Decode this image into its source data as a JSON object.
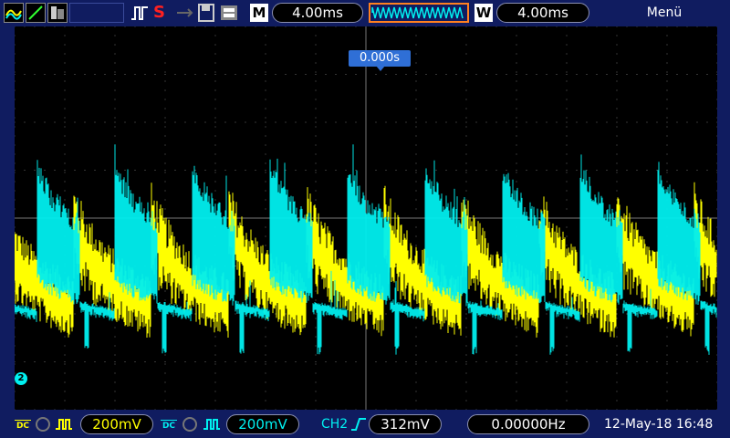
{
  "toolbar": {
    "timebase": "4.00ms",
    "window_timebase": "4.00ms",
    "m_label": "M",
    "w_label": "W",
    "menu_label": "Menü",
    "stop_label": "S"
  },
  "screen": {
    "trigger_position": "0.000s",
    "channel_marker": "2"
  },
  "status": {
    "ch1_coupling": "DC",
    "ch1_scale": "200mV",
    "ch2_coupling": "DC",
    "ch2_scale": "200mV",
    "trigger_source": "CH2",
    "trigger_level": "312mV",
    "frequency": "0.00000Hz",
    "datetime": "12-May-18 16:48"
  },
  "colors": {
    "ch1": "#ffff00",
    "ch2": "#00f0f0",
    "background": "#101c60",
    "screen": "#000000",
    "accent": "#2f6fd6"
  }
}
